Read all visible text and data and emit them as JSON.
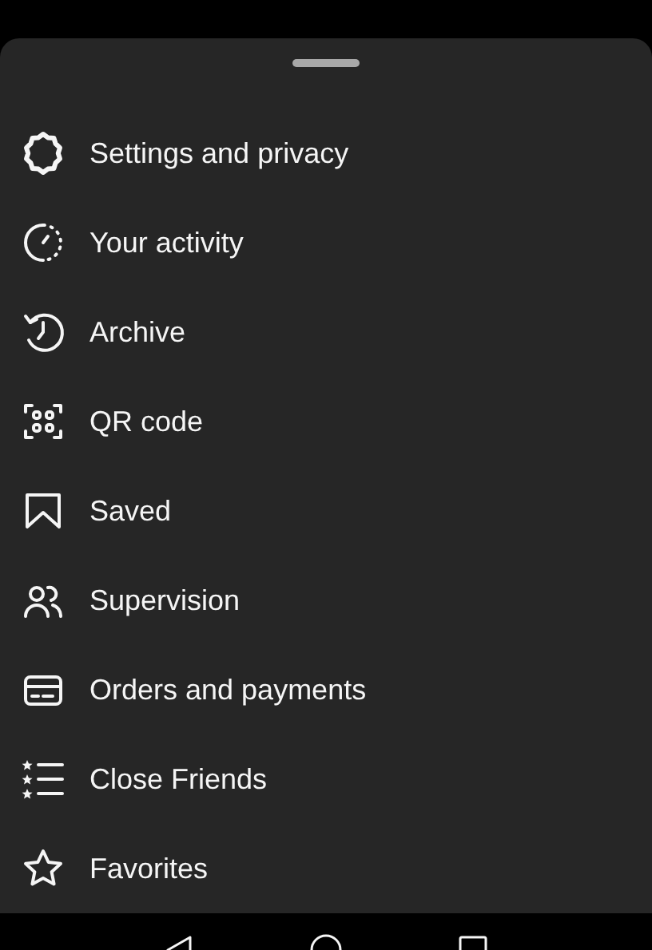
{
  "menu": {
    "items": [
      {
        "kind": "gear",
        "label": "Settings and privacy"
      },
      {
        "kind": "activity",
        "label": "Your activity"
      },
      {
        "kind": "archive",
        "label": "Archive"
      },
      {
        "kind": "qr",
        "label": "QR code"
      },
      {
        "kind": "bookmark",
        "label": "Saved"
      },
      {
        "kind": "people",
        "label": "Supervision"
      },
      {
        "kind": "card",
        "label": "Orders and payments"
      },
      {
        "kind": "starlist",
        "label": "Close Friends"
      },
      {
        "kind": "star",
        "label": "Favorites"
      }
    ]
  }
}
